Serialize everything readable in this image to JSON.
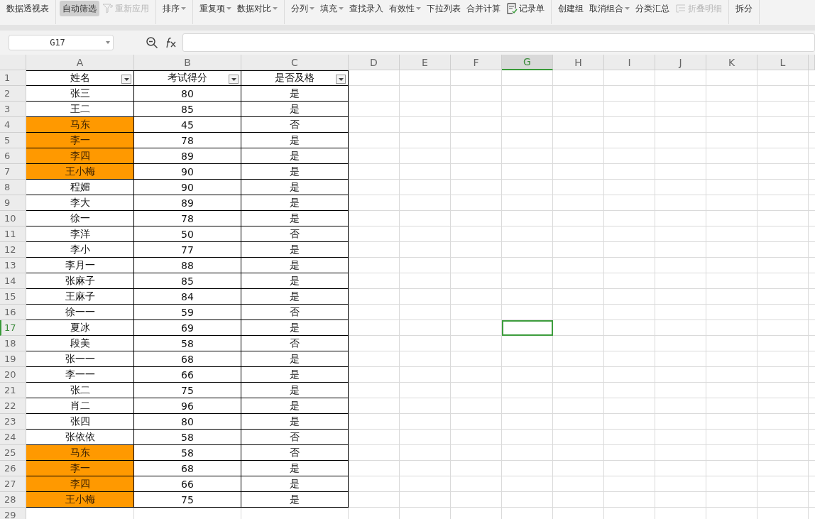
{
  "toolbar": {
    "groups": [
      [
        {
          "label": "数据透视表",
          "kind": "button",
          "selected": false,
          "disabled": false
        }
      ],
      [
        {
          "label": "自动筛选",
          "kind": "button",
          "selected": true,
          "disabled": false
        },
        {
          "label": "重新应用",
          "kind": "filter",
          "selected": false,
          "disabled": true
        }
      ],
      [
        {
          "label": "排序",
          "kind": "dropdown",
          "selected": false,
          "disabled": false
        }
      ],
      [
        {
          "label": "重复项",
          "kind": "dropdown",
          "selected": false,
          "disabled": false
        },
        {
          "label": "数据对比",
          "kind": "dropdown",
          "selected": false,
          "disabled": false
        }
      ],
      [
        {
          "label": "分列",
          "kind": "dropdown",
          "selected": false,
          "disabled": false
        },
        {
          "label": "填充",
          "kind": "dropdown",
          "selected": false,
          "disabled": false
        },
        {
          "label": "查找录入",
          "kind": "button",
          "selected": false,
          "disabled": false
        },
        {
          "label": "有效性",
          "kind": "dropdown",
          "selected": false,
          "disabled": false
        },
        {
          "label": "下拉列表",
          "kind": "button",
          "selected": false,
          "disabled": false
        },
        {
          "label": "合并计算",
          "kind": "button",
          "selected": false,
          "disabled": false
        },
        {
          "label": "记录单",
          "kind": "form",
          "selected": false,
          "disabled": false
        }
      ],
      [
        {
          "label": "创建组",
          "kind": "button",
          "selected": false,
          "disabled": false
        },
        {
          "label": "取消组合",
          "kind": "dropdown",
          "selected": false,
          "disabled": false
        },
        {
          "label": "分类汇总",
          "kind": "button",
          "selected": false,
          "disabled": false
        },
        {
          "label": "折叠明细",
          "kind": "collapse",
          "selected": false,
          "disabled": true
        }
      ],
      [
        {
          "label": "拆分",
          "kind": "button",
          "selected": false,
          "disabled": false
        }
      ]
    ]
  },
  "name_box": {
    "value": "G17"
  },
  "sheet": {
    "columns": [
      {
        "label": "A",
        "selected": false
      },
      {
        "label": "B",
        "selected": false
      },
      {
        "label": "C",
        "selected": false
      },
      {
        "label": "D",
        "selected": false
      },
      {
        "label": "E",
        "selected": false
      },
      {
        "label": "F",
        "selected": false
      },
      {
        "label": "G",
        "selected": true
      },
      {
        "label": "H",
        "selected": false
      },
      {
        "label": "I",
        "selected": false
      },
      {
        "label": "J",
        "selected": false
      },
      {
        "label": "K",
        "selected": false
      },
      {
        "label": "L",
        "selected": false
      }
    ],
    "row_numbers": [
      {
        "label": "1",
        "selected": false
      },
      {
        "label": "2",
        "selected": false
      },
      {
        "label": "3",
        "selected": false
      },
      {
        "label": "4",
        "selected": false
      },
      {
        "label": "5",
        "selected": false
      },
      {
        "label": "6",
        "selected": false
      },
      {
        "label": "7",
        "selected": false
      },
      {
        "label": "8",
        "selected": false
      },
      {
        "label": "9",
        "selected": false
      },
      {
        "label": "10",
        "selected": false
      },
      {
        "label": "11",
        "selected": false
      },
      {
        "label": "12",
        "selected": false
      },
      {
        "label": "13",
        "selected": false
      },
      {
        "label": "14",
        "selected": false
      },
      {
        "label": "15",
        "selected": false
      },
      {
        "label": "16",
        "selected": false
      },
      {
        "label": "17",
        "selected": true
      },
      {
        "label": "18",
        "selected": false
      },
      {
        "label": "19",
        "selected": false
      },
      {
        "label": "20",
        "selected": false
      },
      {
        "label": "21",
        "selected": false
      },
      {
        "label": "22",
        "selected": false
      },
      {
        "label": "23",
        "selected": false
      },
      {
        "label": "24",
        "selected": false
      },
      {
        "label": "25",
        "selected": false
      },
      {
        "label": "26",
        "selected": false
      },
      {
        "label": "27",
        "selected": false
      },
      {
        "label": "28",
        "selected": false
      },
      {
        "label": "29",
        "selected": false
      }
    ],
    "header": [
      "姓名",
      "考试得分",
      "是否及格"
    ],
    "rows": [
      {
        "cells": [
          "张三",
          "80",
          "是"
        ],
        "highlighted": false
      },
      {
        "cells": [
          "王二",
          "85",
          "是"
        ],
        "highlighted": false
      },
      {
        "cells": [
          "马东",
          "45",
          "否"
        ],
        "highlighted": true
      },
      {
        "cells": [
          "李一",
          "78",
          "是"
        ],
        "highlighted": true
      },
      {
        "cells": [
          "李四",
          "89",
          "是"
        ],
        "highlighted": true
      },
      {
        "cells": [
          "王小梅",
          "90",
          "是"
        ],
        "highlighted": true
      },
      {
        "cells": [
          "程媚",
          "90",
          "是"
        ],
        "highlighted": false
      },
      {
        "cells": [
          "李大",
          "89",
          "是"
        ],
        "highlighted": false
      },
      {
        "cells": [
          "徐一",
          "78",
          "是"
        ],
        "highlighted": false
      },
      {
        "cells": [
          "李洋",
          "50",
          "否"
        ],
        "highlighted": false
      },
      {
        "cells": [
          "李小",
          "77",
          "是"
        ],
        "highlighted": false
      },
      {
        "cells": [
          "李月一",
          "88",
          "是"
        ],
        "highlighted": false
      },
      {
        "cells": [
          "张麻子",
          "85",
          "是"
        ],
        "highlighted": false
      },
      {
        "cells": [
          "王麻子",
          "84",
          "是"
        ],
        "highlighted": false
      },
      {
        "cells": [
          "徐一一",
          "59",
          "否"
        ],
        "highlighted": false
      },
      {
        "cells": [
          "夏冰",
          "69",
          "是"
        ],
        "highlighted": false
      },
      {
        "cells": [
          "段美",
          "58",
          "否"
        ],
        "highlighted": false
      },
      {
        "cells": [
          "张一一",
          "68",
          "是"
        ],
        "highlighted": false
      },
      {
        "cells": [
          "李一一",
          "66",
          "是"
        ],
        "highlighted": false
      },
      {
        "cells": [
          "张二",
          "75",
          "是"
        ],
        "highlighted": false
      },
      {
        "cells": [
          "肖二",
          "96",
          "是"
        ],
        "highlighted": false
      },
      {
        "cells": [
          "张四",
          "80",
          "是"
        ],
        "highlighted": false
      },
      {
        "cells": [
          "张依依",
          "58",
          "否"
        ],
        "highlighted": false
      },
      {
        "cells": [
          "马东",
          "58",
          "否"
        ],
        "highlighted": true
      },
      {
        "cells": [
          "李一",
          "68",
          "是"
        ],
        "highlighted": true
      },
      {
        "cells": [
          "李四",
          "66",
          "是"
        ],
        "highlighted": true
      },
      {
        "cells": [
          "王小梅",
          "75",
          "是"
        ],
        "highlighted": true
      }
    ]
  }
}
